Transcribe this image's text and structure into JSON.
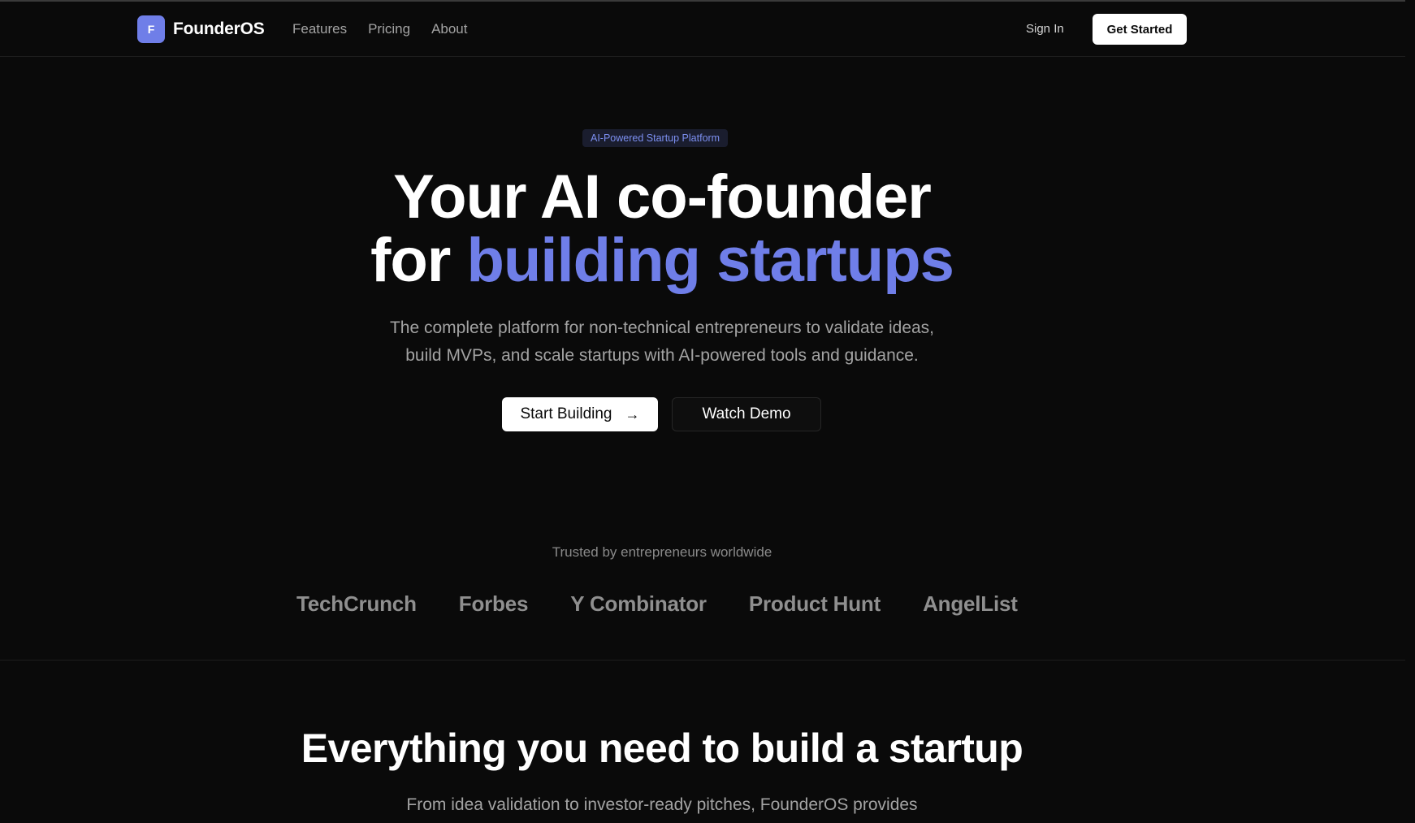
{
  "nav": {
    "logo_letter": "F",
    "brand": "FounderOS",
    "links": [
      "Features",
      "Pricing",
      "About"
    ],
    "sign_in": "Sign In",
    "get_started": "Get Started"
  },
  "hero": {
    "badge": "AI-Powered Startup Platform",
    "title_line1": "Your AI co-founder",
    "title_line2_plain": "for ",
    "title_line2_accent": "building startups",
    "subtitle_line1": "The complete platform for non-technical entrepreneurs to validate ideas,",
    "subtitle_line2": "build MVPs, and scale startups with AI-powered tools and guidance.",
    "primary_cta": "Start Building",
    "primary_cta_icon": "arrow-right-icon",
    "secondary_cta": "Watch Demo"
  },
  "trusted": {
    "label": "Trusted by entrepreneurs worldwide",
    "logos": [
      "TechCrunch",
      "Forbes",
      "Y Combinator",
      "Product Hunt",
      "AngelList"
    ]
  },
  "features": {
    "title": "Everything you need to build a startup",
    "subtitle": "From idea validation to investor-ready pitches, FounderOS provides"
  },
  "colors": {
    "background": "#0a0a0a",
    "accent": "#6f7ee8",
    "muted_text": "#a3a3a3"
  }
}
